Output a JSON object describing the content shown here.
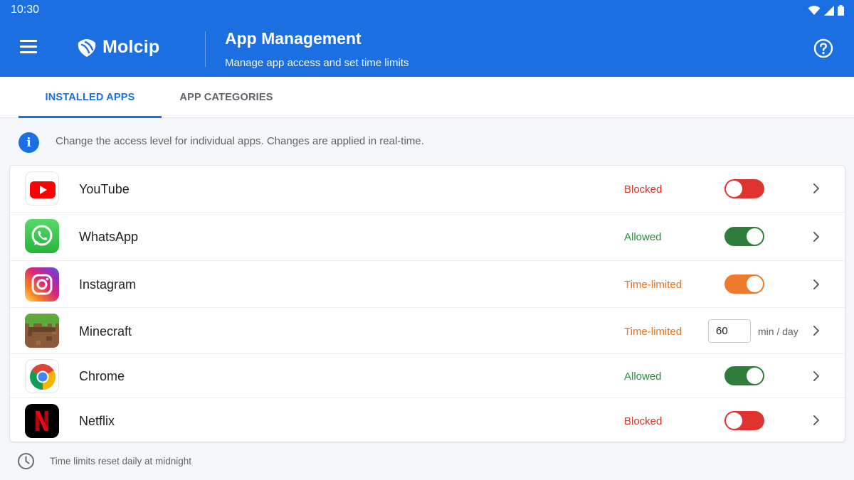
{
  "status_bar": {
    "time": "10:30"
  },
  "header": {
    "logo_text": "Molcip",
    "title": "App Management",
    "subtitle": "Manage app access and set time limits"
  },
  "tabs": [
    {
      "label": "INSTALLED APPS",
      "active": true
    },
    {
      "label": "APP CATEGORIES",
      "active": false
    }
  ],
  "info": {
    "text": "Change the access level for individual apps. Changes are applied in real-time."
  },
  "apps": [
    {
      "name": "YouTube",
      "status": "Blocked",
      "status_color": "#d93025",
      "toggle": "off",
      "toggle_color": "#e0322f",
      "icon": "youtube-icon"
    },
    {
      "name": "WhatsApp",
      "status": "Allowed",
      "status_color": "#2e8b3e",
      "toggle": "on",
      "toggle_color": "#2e7d3a",
      "icon": "whatsapp-icon"
    },
    {
      "name": "Instagram",
      "status": "Time-limited",
      "status_color": "#e8711a",
      "toggle": "on",
      "toggle_color": "#ee7a2c",
      "icon": "instagram-icon"
    },
    {
      "name": "Minecraft",
      "status": "Time-limited",
      "status_color": "#e8711a",
      "limit_value": "60",
      "limit_unit": "min / day",
      "icon": "minecraft-icon"
    },
    {
      "name": "Chrome",
      "status": "Allowed",
      "status_color": "#2e8b3e",
      "toggle": "on",
      "toggle_color": "#2e7d3a",
      "icon": "chrome-icon"
    },
    {
      "name": "Netflix",
      "status": "Blocked",
      "status_color": "#d93025",
      "toggle": "off",
      "toggle_color": "#e0322f",
      "icon": "netflix-icon"
    }
  ],
  "footer": {
    "text": "Time limits reset daily at midnight"
  },
  "colors": {
    "primary": "#1b6fe0",
    "background": "#f4f6fa"
  }
}
